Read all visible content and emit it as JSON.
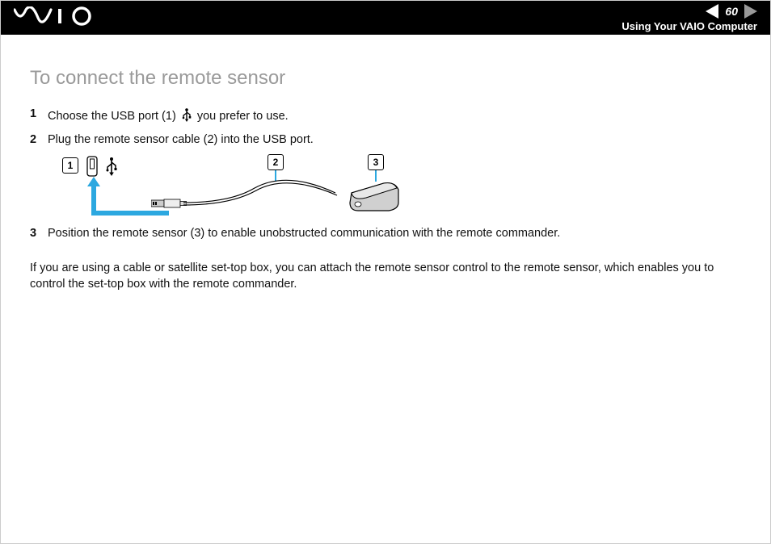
{
  "header": {
    "page_number": "60",
    "section": "Using Your VAIO Computer"
  },
  "content": {
    "title": "To connect the remote sensor",
    "steps": [
      {
        "num": "1",
        "text_before": "Choose the USB port (1) ",
        "text_after": " you prefer to use."
      },
      {
        "num": "2",
        "text": "Plug the remote sensor cable (2) into the USB port."
      },
      {
        "num": "3",
        "text": "Position the remote sensor (3) to enable unobstructed communication with the remote commander."
      }
    ],
    "diagram": {
      "callouts": {
        "c1": "1",
        "c2": "2",
        "c3": "3"
      }
    },
    "note": "If you are using a cable or satellite set-top box, you can attach the remote sensor control to the remote sensor, which enables you to control the set-top box with the remote commander."
  }
}
